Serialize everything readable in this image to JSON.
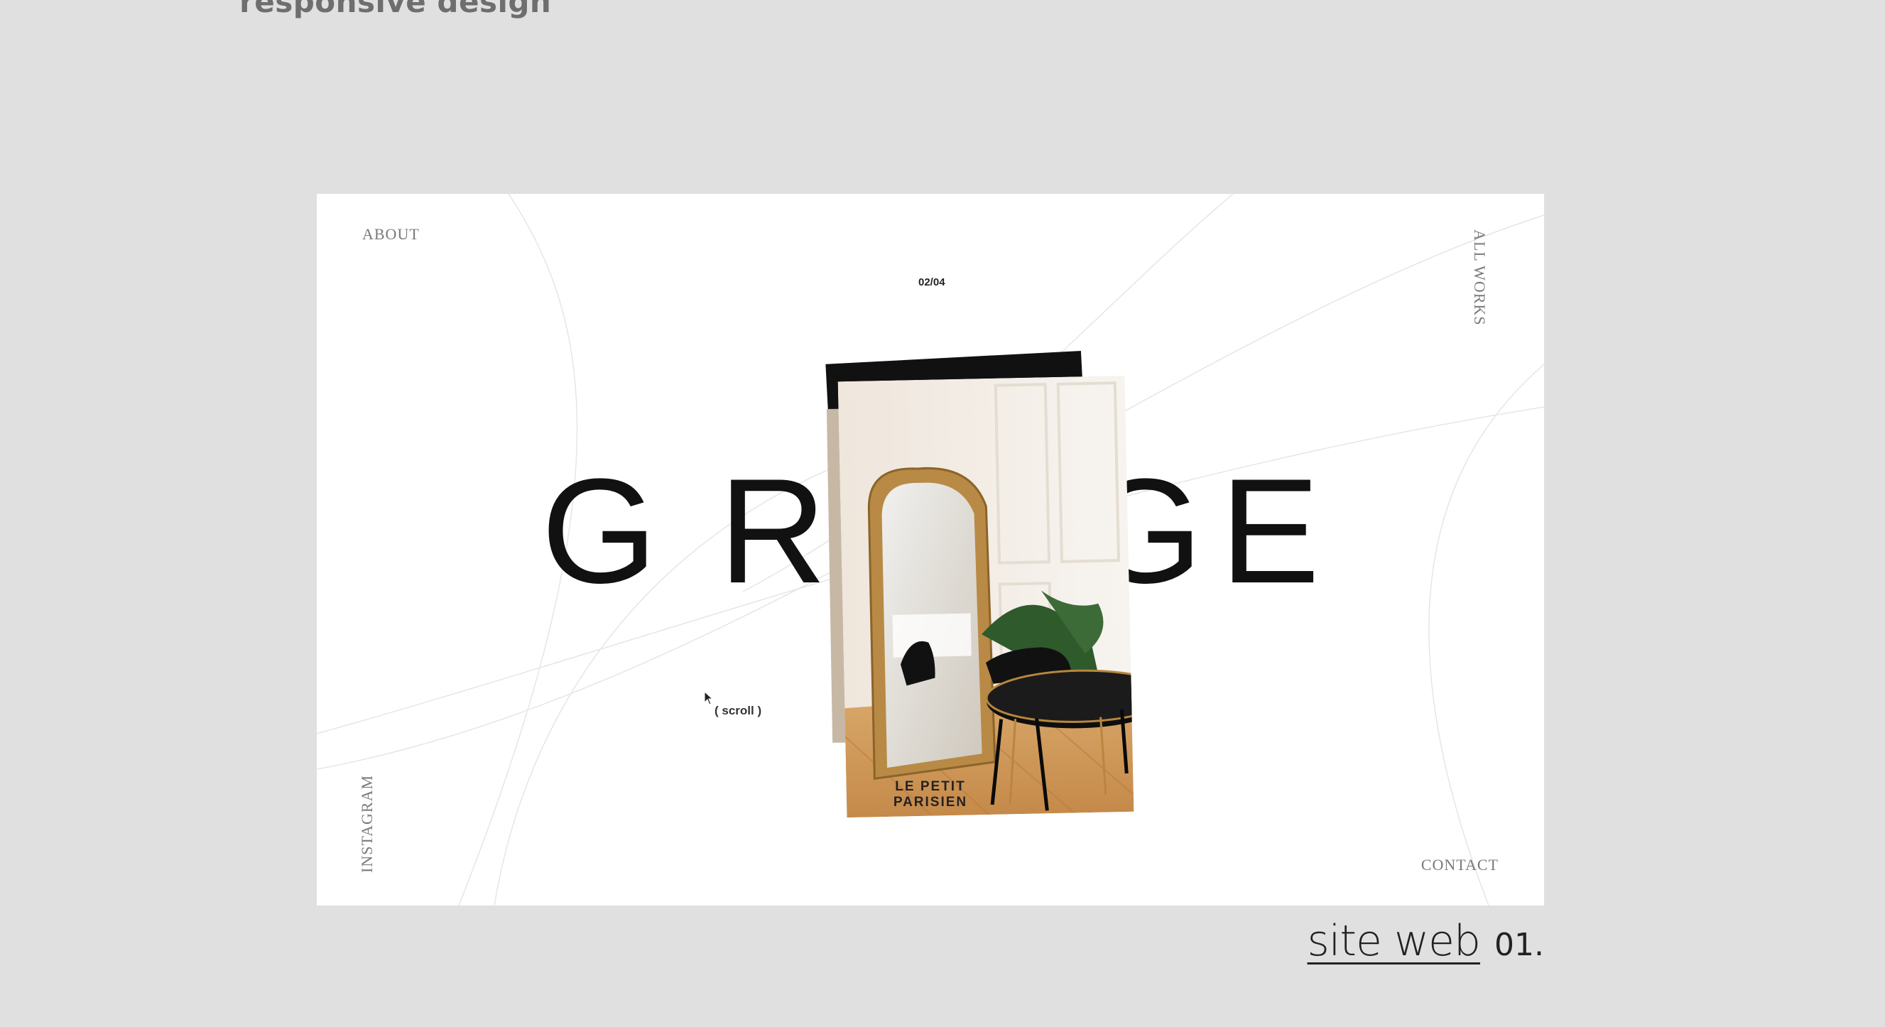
{
  "page": {
    "heading": "responsive design",
    "background": "#e0e0e0"
  },
  "site": {
    "nav": {
      "about": "ABOUT",
      "all_works": "ALL WORKS",
      "instagram": "INSTAGRAM",
      "contact": "CONTACT"
    },
    "counter": "02/04",
    "hero_letters": [
      "G",
      "R",
      "G",
      "E"
    ],
    "scroll_hint": "( scroll )",
    "project_title_line1": "LE PETIT",
    "project_title_line2": "PARISIEN",
    "photo_icon": "interior-photo-icon",
    "cursor_icon": "cursor-arrow-icon"
  },
  "caption": {
    "link_label": "site web",
    "number": "01."
  },
  "colors": {
    "frame_bg": "#ffffff",
    "text_dark": "#111111",
    "muted": "#7a7a7a"
  }
}
